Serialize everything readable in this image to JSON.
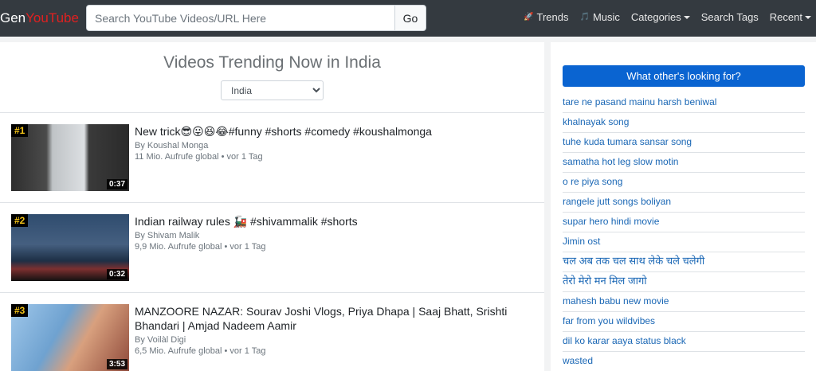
{
  "navbar": {
    "brand_gen": "Gen",
    "brand_youtube": "YouTube",
    "search_placeholder": "Search YouTube Videos/URL Here",
    "go_label": "Go",
    "links": [
      {
        "label": "Trends",
        "icon": "rocket-icon",
        "glyph": "🚀"
      },
      {
        "label": "Music",
        "icon": "music-note-icon",
        "glyph": "🎵"
      },
      {
        "label": "Categories",
        "dropdown": true
      },
      {
        "label": "Search Tags"
      },
      {
        "label": "Recent",
        "dropdown": true
      }
    ]
  },
  "main": {
    "title": "Videos Trending Now in India",
    "country_selected": "India",
    "videos": [
      {
        "rank": "#1",
        "duration": "0:37",
        "title": "New trick😎😛😆😂#funny #shorts #comedy #koushalmonga",
        "channel": "By Koushal Monga",
        "meta": "11 Mio. Aufrufe global • vor 1 Tag"
      },
      {
        "rank": "#2",
        "duration": "0:32",
        "title": "Indian railway rules 🚂 #shivammalik #shorts",
        "channel": "By Shivam Malik",
        "meta": "9,9 Mio. Aufrufe global • vor 1 Tag"
      },
      {
        "rank": "#3",
        "duration": "3:53",
        "title": "MANZOORE NAZAR: Sourav Joshi Vlogs, Priya Dhapa | Saaj Bhatt, Srishti Bhandari | Amjad Nadeem Aamir",
        "channel": "By Voilàl Digi",
        "meta": "6,5 Mio. Aufrufe global • vor 1 Tag"
      }
    ]
  },
  "sidebar": {
    "header": "What other's looking for?",
    "tags": [
      "tare ne pasand mainu harsh beniwal",
      "khalnayak song",
      "tuhe kuda tumara sansar song",
      "samatha hot leg slow motin",
      "o re piya song",
      "rangele jutt songs boliyan",
      "supar hero hindi movie",
      "Jimin ost",
      "चल अब तक चल साथ लेके चले चलेगी",
      "तेरो मेरो मन मिल जागो",
      "mahesh babu new movie",
      "far from you wildvibes",
      "dil ko karar aaya status black",
      "wasted"
    ]
  }
}
